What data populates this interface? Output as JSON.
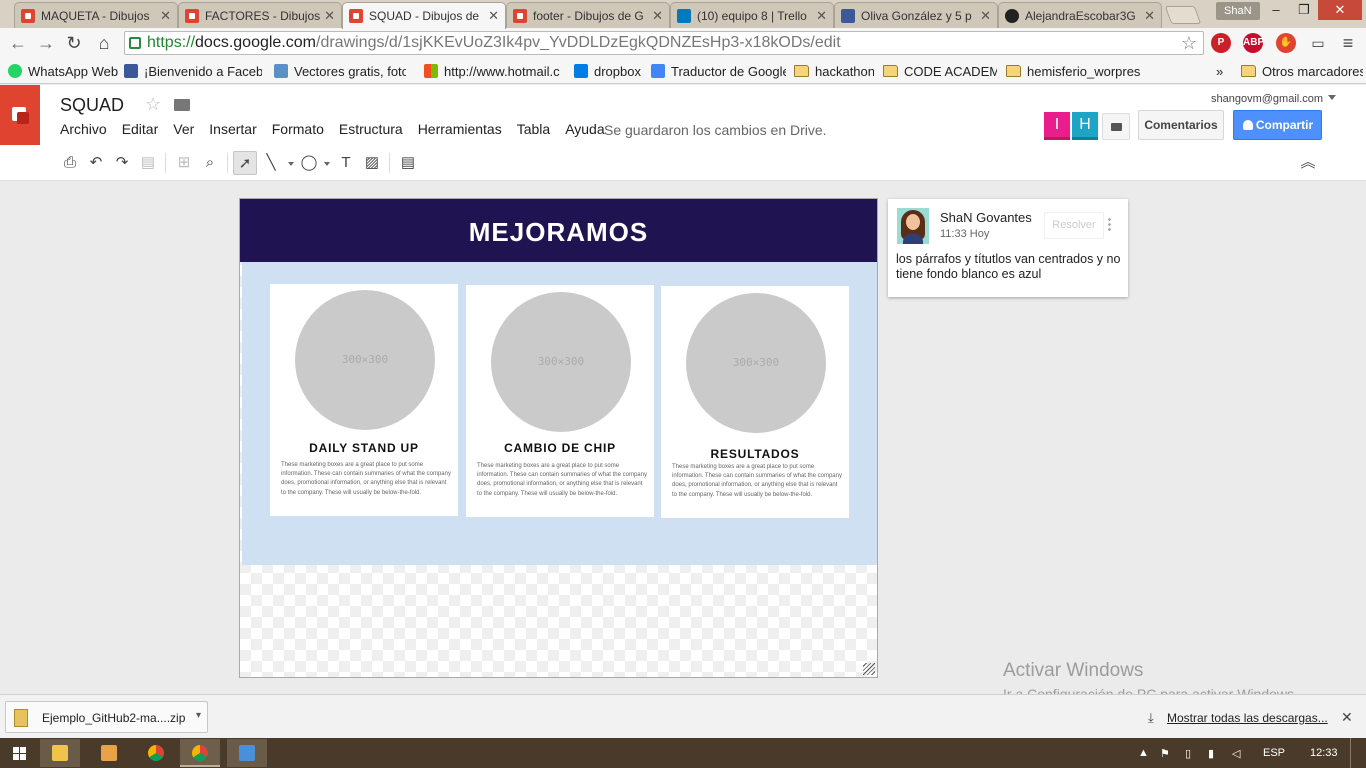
{
  "browser": {
    "tabs": [
      {
        "title": "MAQUETA - Dibujos",
        "icon": "drawings-icon"
      },
      {
        "title": "FACTORES - Dibujos",
        "icon": "drawings-icon"
      },
      {
        "title": "SQUAD - Dibujos de",
        "icon": "drawings-icon",
        "active": true
      },
      {
        "title": "footer - Dibujos de G",
        "icon": "drawings-icon"
      },
      {
        "title": "(10) equipo 8 | Trello",
        "icon": "trello-icon"
      },
      {
        "title": "Oliva González y 5 p",
        "icon": "facebook-icon"
      },
      {
        "title": "AlejandraEscobar3G",
        "icon": "github-icon"
      }
    ],
    "tab_close": "✕",
    "profile_name": "ShaN",
    "url": {
      "proto": "https://",
      "host": "docs.google.com",
      "path": "/drawings/d/1sjKKEvUoZ3Ik4pv_YvDDLDzEgkQDNZEsHp3-x18kODs/edit"
    },
    "extensions": [
      {
        "name": "pinterest-icon",
        "label": "P",
        "color": "#cb2027"
      },
      {
        "name": "adblock-icon",
        "label": "ABP",
        "color": "#c70d2c"
      },
      {
        "name": "adblock-stop-icon",
        "label": "✋",
        "color": "#e0432f"
      }
    ],
    "bookmarks": [
      {
        "label": "WhatsApp Web",
        "icon": "whatsapp-icon",
        "color": "#25d366"
      },
      {
        "label": "¡Bienvenido a Facebook",
        "icon": "facebook-icon",
        "color": "#3b5998"
      },
      {
        "label": "Vectores gratis, fotos",
        "icon": "freepik-icon",
        "color": "#5b8fc7"
      },
      {
        "label": "http://www.hotmail.co",
        "icon": "windows-icon",
        "color": "#f25022"
      },
      {
        "label": "dropbox",
        "icon": "dropbox-icon",
        "color": "#007ee5"
      },
      {
        "label": "Traductor de Google",
        "icon": "translate-icon",
        "color": "#4285f4"
      },
      {
        "label": "hackathon",
        "icon": "folder-icon"
      },
      {
        "label": "CODE ACADEMY",
        "icon": "folder-icon"
      },
      {
        "label": "hemisferio_worpress",
        "icon": "folder-icon"
      }
    ],
    "bookmarks_overflow": "»",
    "other_bookmarks": "Otros marcadores"
  },
  "app": {
    "doc_title": "SQUAD",
    "menu": [
      "Archivo",
      "Editar",
      "Ver",
      "Insertar",
      "Formato",
      "Estructura",
      "Herramientas",
      "Tabla",
      "Ayuda"
    ],
    "save_status": "Se guardaron los cambios en Drive.",
    "account_email": "shangovm@gmail.com",
    "collaborators": [
      {
        "initial": "I",
        "color": "#e91e8c",
        "underline": "#c2185b"
      },
      {
        "initial": "H",
        "color": "#1ea5c5",
        "underline": "#0f7f99"
      }
    ],
    "comments_button": "Comentarios",
    "share_button": "Compartir"
  },
  "drawing": {
    "banner_title": "MEJORAMOS",
    "banner_color": "#201351",
    "panel_color": "#cfe0f3",
    "placeholder_text": "300×300",
    "cards": [
      {
        "title": "DAILY STAND UP",
        "text": "These marketing boxes are a great place to put some information. These can contain summaries of what the company does, promotional information, or anything else that is relevant to the company. These will usually be below-the-fold."
      },
      {
        "title": "CAMBIO DE CHIP",
        "text": "These marketing boxes are a great place to put some information. These can contain summaries of what the company does, promotional information, or anything else that is relevant to the company. These will usually be below-the-fold."
      },
      {
        "title": "RESULTADOS",
        "text": "These marketing boxes are a great place to put some information. These can contain summaries of what the company does, promotional information, or anything else that is relevant to the company. These will usually be below-the-fold."
      }
    ]
  },
  "comment": {
    "author": "ShaN Govantes",
    "time": "11:33 Hoy",
    "resolve_label": "Resolver",
    "body": "los párrafos y títutlos van centrados y no tiene fondo blanco es azul"
  },
  "watermark": {
    "line1": "Activar Windows",
    "line2": "Ir a Configuración de PC para activar Windows."
  },
  "downloads": {
    "file_name": "Ejemplo_GitHub2-ma....zip",
    "show_all": "Mostrar todas las descargas..."
  },
  "taskbar": {
    "language": "ESP",
    "clock": "12:33"
  }
}
